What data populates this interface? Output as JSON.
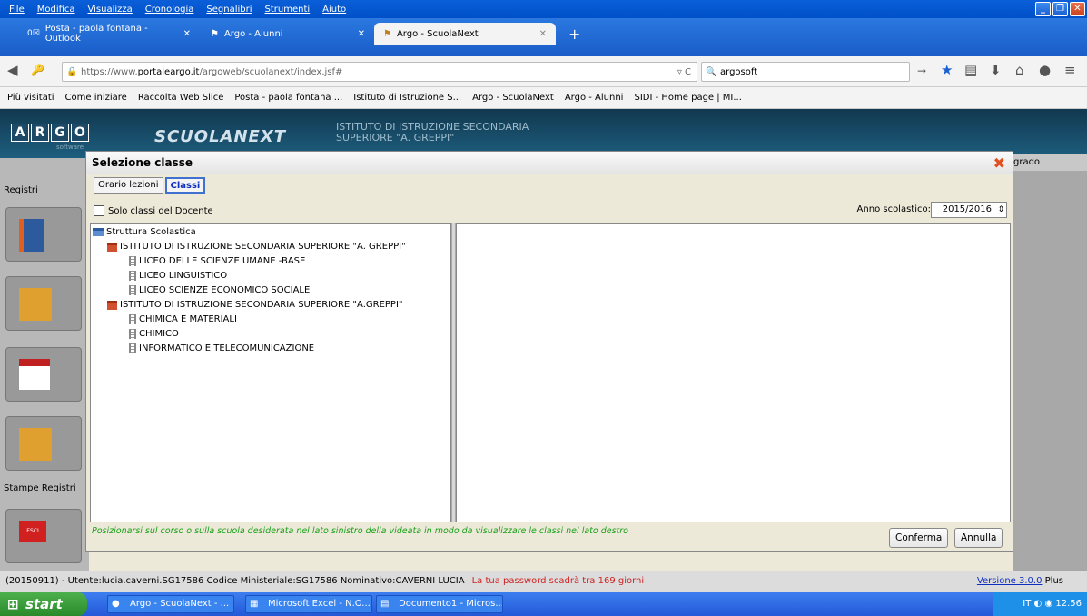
{
  "menubar": {
    "items": [
      "File",
      "Modifica",
      "Visualizza",
      "Cronologia",
      "Segnalibri",
      "Strumenti",
      "Aiuto"
    ]
  },
  "browser_tabs": [
    {
      "label": "Posta - paola fontana - Outlook"
    },
    {
      "label": "Argo - Alunni"
    },
    {
      "label": "Argo - ScuolaNext"
    }
  ],
  "navbar": {
    "url_prefix": "https://www.",
    "url_domain": "portaleargo.it",
    "url_path": "/argoweb/scuolanext/index.jsf#",
    "search_value": "argosoft"
  },
  "bookmarks": [
    "Più visitati",
    "Come iniziare",
    "Raccolta Web Slice",
    "Posta - paola fontana ...",
    "Istituto di Istruzione S...",
    "Argo - ScuolaNext",
    "Argo - Alunni",
    "SIDI - Home page | MI..."
  ],
  "app": {
    "logo": [
      "A",
      "R",
      "G",
      "O"
    ],
    "logo_sub": "software",
    "product": "SCUOLANEXT",
    "school_line1": "ISTITUTO DI ISTRUZIONE SECONDARIA",
    "school_line2": "SUPERIORE \"A. GREPPI\"",
    "grado": "grado"
  },
  "left": {
    "registri": "Registri",
    "stampe": "Stampe Registri",
    "esci": "ESCI"
  },
  "dialog": {
    "title": "Selezione classe",
    "tabs": [
      "Orario lezioni",
      "Classi"
    ],
    "filter_label": "Solo classi del Docente",
    "anno_label": "Anno scolastico:",
    "anno_value": "2015/2016",
    "tree": {
      "root": "Struttura Scolastica",
      "inst1": "ISTITUTO DI ISTRUZIONE SECONDARIA SUPERIORE \"A. GREPPI\"",
      "inst1_items": [
        "LICEO DELLE SCIENZE UMANE -BASE",
        "LICEO LINGUISTICO",
        "LICEO SCIENZE ECONOMICO SOCIALE"
      ],
      "inst2": "ISTITUTO DI ISTRUZIONE SECONDARIA SUPERIORE \"A.GREPPI\"",
      "inst2_items": [
        "CHIMICA E MATERIALI",
        "CHIMICO",
        "INFORMATICO E TELECOMUNICAZIONE"
      ]
    },
    "hint": "Posizionarsi sul corso o sulla scuola desiderata nel lato sinistro della videata in modo da visualizzare le classi nel lato destro",
    "confirm": "Conferma",
    "cancel": "Annulla"
  },
  "statusbar": {
    "text": "(20150911) - Utente:lucia.caverni.SG17586 Codice Ministeriale:SG17586 Nominativo:CAVERNI LUCIA",
    "warning": "La tua password scadrà tra 169 giorni",
    "version_link": "Versione 3.0.0",
    "version_suffix": "Plus"
  },
  "taskbar": {
    "start": "start",
    "tasks": [
      "Argo - ScuolaNext - ...",
      "Microsoft Excel - N.O...",
      "Documento1 - Micros..."
    ],
    "lang": "IT",
    "time": "12.56"
  }
}
